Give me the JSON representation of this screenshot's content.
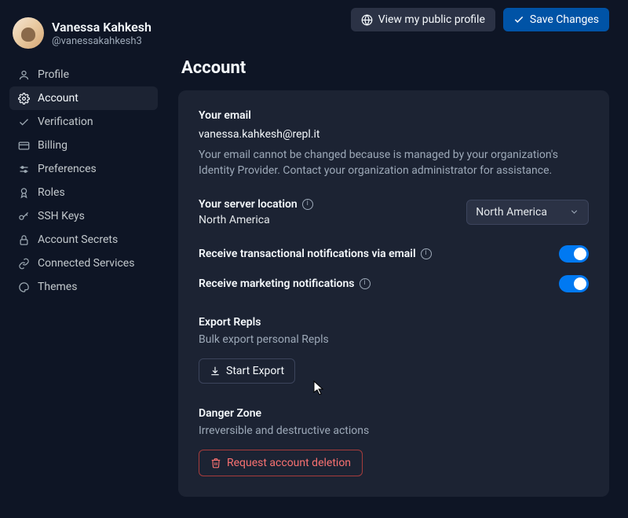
{
  "user": {
    "name": "Vanessa Kahkesh",
    "handle": "@vanessakahkesh3"
  },
  "nav": {
    "items": [
      {
        "label": "Profile"
      },
      {
        "label": "Account"
      },
      {
        "label": "Verification"
      },
      {
        "label": "Billing"
      },
      {
        "label": "Preferences"
      },
      {
        "label": "Roles"
      },
      {
        "label": "SSH Keys"
      },
      {
        "label": "Account Secrets"
      },
      {
        "label": "Connected Services"
      },
      {
        "label": "Themes"
      }
    ]
  },
  "topbar": {
    "view_public": "View my public profile",
    "save": "Save Changes"
  },
  "page": {
    "title": "Account"
  },
  "email": {
    "label": "Your email",
    "value": "vanessa.kahkesh@repl.it",
    "note": "Your email cannot be changed because is managed by your organization's Identity Provider. Contact your organization administrator for assistance."
  },
  "server": {
    "label": "Your server location",
    "value": "North America",
    "select_value": "North America"
  },
  "notifications": {
    "transactional_label": "Receive transactional notifications via email",
    "transactional_on": true,
    "marketing_label": "Receive marketing notifications",
    "marketing_on": true
  },
  "export": {
    "title": "Export Repls",
    "subtitle": "Bulk export personal Repls",
    "button": "Start Export"
  },
  "danger": {
    "title": "Danger Zone",
    "subtitle": "Irreversible and destructive actions",
    "button": "Request account deletion"
  }
}
